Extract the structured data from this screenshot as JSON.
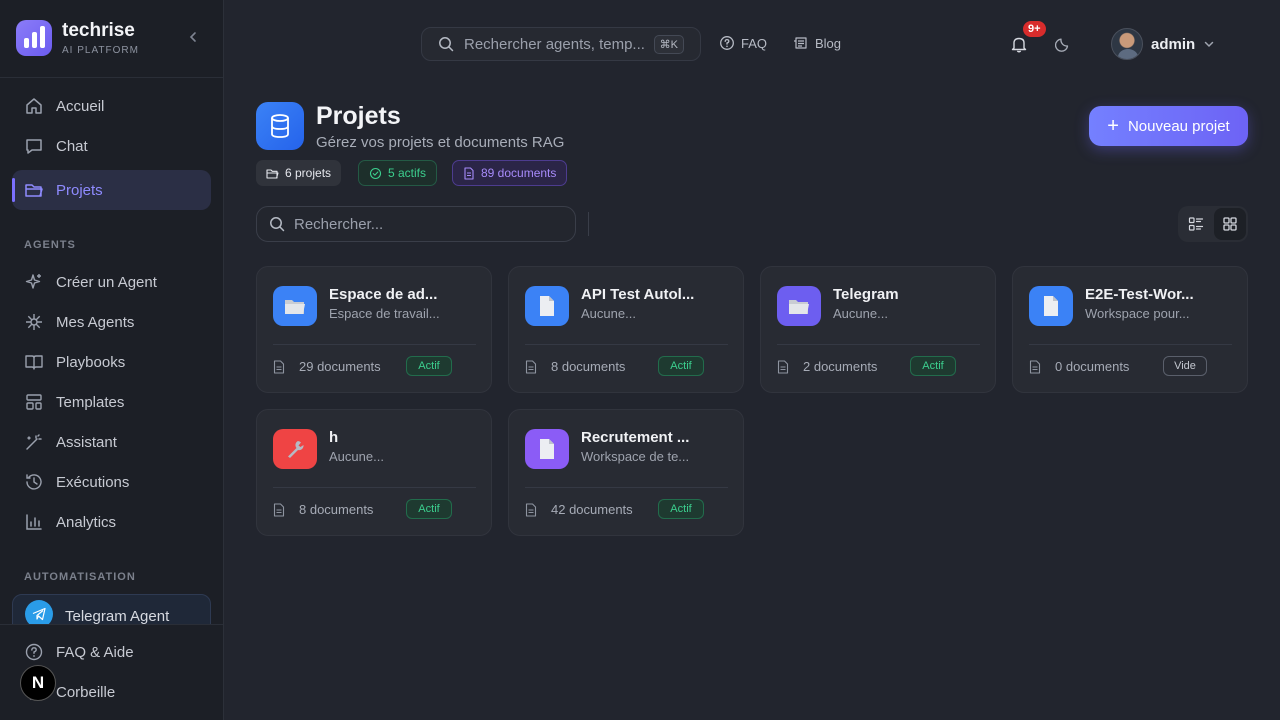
{
  "sidebar": {
    "brand": {
      "name": "techrise",
      "subtitle": "AI PLATFORM"
    },
    "main_nav": [
      {
        "label": "Accueil",
        "icon": "home-icon"
      },
      {
        "label": "Chat",
        "icon": "chat-icon"
      },
      {
        "label": "Projets",
        "icon": "folder-icon",
        "active": true
      }
    ],
    "agents_label": "AGENTS",
    "agents_nav": [
      {
        "label": "Créer un Agent",
        "icon": "sparkles-icon"
      },
      {
        "label": "Mes Agents",
        "icon": "asterisk-icon"
      },
      {
        "label": "Playbooks",
        "icon": "book-icon"
      },
      {
        "label": "Templates",
        "icon": "layout-icon"
      },
      {
        "label": "Assistant",
        "icon": "magic-wand-icon"
      },
      {
        "label": "Exécutions",
        "icon": "history-icon"
      },
      {
        "label": "Analytics",
        "icon": "bar-chart-icon"
      }
    ],
    "automation_label": "AUTOMATISATION",
    "telegram_agent": "Telegram Agent",
    "bottom_nav": [
      {
        "label": "FAQ & Aide",
        "icon": "help-circle-icon"
      },
      {
        "label": "Corbeille",
        "icon": "trash-icon"
      }
    ]
  },
  "topbar": {
    "search_placeholder": "Rechercher agents, temp...",
    "shortcut": "⌘K",
    "faq": "FAQ",
    "blog": "Blog",
    "notification_count": "9+",
    "user_name": "admin"
  },
  "page": {
    "title": "Projets",
    "subtitle": "Gérez vos projets et documents RAG",
    "stats": {
      "projects": "6 projets",
      "active": "5 actifs",
      "documents": "89 documents"
    },
    "new_button": "Nouveau projet",
    "search_placeholder": "Rechercher..."
  },
  "projects": [
    {
      "title": "Espace de ad...",
      "desc": "Espace de travail...",
      "docs": "29 documents",
      "status": "Actif",
      "icon": "folder-emoji-icon",
      "color": "#3b82f6"
    },
    {
      "title": "API Test Autol...",
      "desc": "Aucune...",
      "docs": "8 documents",
      "status": "Actif",
      "icon": "page-emoji-icon",
      "color": "#3b82f6"
    },
    {
      "title": "Telegram",
      "desc": "Aucune...",
      "docs": "2 documents",
      "status": "Actif",
      "icon": "folder-emoji-icon",
      "color": "#6d5ef0"
    },
    {
      "title": "E2E-Test-Wor...",
      "desc": "Workspace pour...",
      "docs": "0 documents",
      "status": "Vide",
      "icon": "page-emoji-icon",
      "color": "#3b82f6"
    },
    {
      "title": "h",
      "desc": "Aucune...",
      "docs": "8 documents",
      "status": "Actif",
      "icon": "wrench-emoji-icon",
      "color": "#ef4444"
    },
    {
      "title": "Recrutement ...",
      "desc": "Workspace de te...",
      "docs": "42 documents",
      "status": "Actif",
      "icon": "page-emoji-icon",
      "color": "#8b5cf6"
    }
  ]
}
